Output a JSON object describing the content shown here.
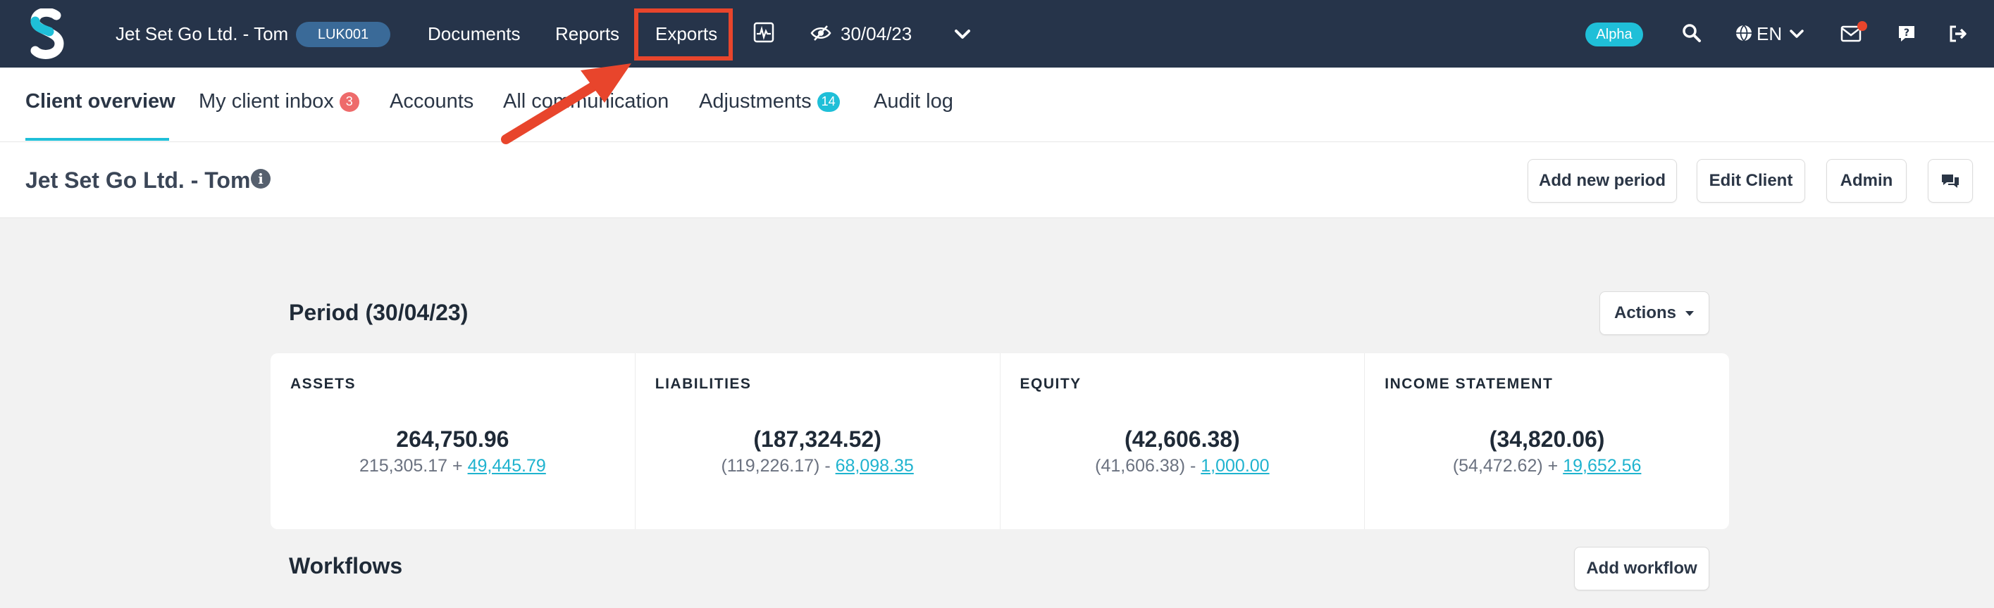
{
  "topbar": {
    "client_name": "Jet Set Go Ltd. - Tom",
    "client_code": "LUK001",
    "nav": {
      "documents": "Documents",
      "reports": "Reports",
      "exports": "Exports"
    },
    "period_date": "30/04/23",
    "alpha_badge": "Alpha",
    "language": "EN",
    "highlight_color": "#e8452c",
    "icons": [
      "logo-s-icon",
      "activity-chart-icon",
      "eye-slash-icon",
      "chevron-down-icon",
      "search-icon",
      "globe-icon",
      "mail-icon",
      "help-icon",
      "logout-icon"
    ]
  },
  "tabs": [
    {
      "label": "Client overview",
      "active": true
    },
    {
      "label": "My client inbox",
      "count": "3"
    },
    {
      "label": "Accounts"
    },
    {
      "label": "All communication"
    },
    {
      "label": "Adjustments",
      "count": "14"
    },
    {
      "label": "Audit log"
    }
  ],
  "header": {
    "title": "Jet Set Go Ltd. - Tom",
    "buttons": {
      "add_period": "Add new period",
      "edit_client": "Edit Client",
      "admin": "Admin"
    }
  },
  "period": {
    "title": "Period (30/04/23)",
    "actions_label": "Actions",
    "columns": [
      {
        "label": "ASSETS",
        "total": "264,750.96",
        "base": "215,305.17",
        "op": "+",
        "adjustment": "49,445.79"
      },
      {
        "label": "LIABILITIES",
        "total": "(187,324.52)",
        "base": "(119,226.17)",
        "op": "-",
        "adjustment": "68,098.35"
      },
      {
        "label": "EQUITY",
        "total": "(42,606.38)",
        "base": "(41,606.38)",
        "op": "-",
        "adjustment": "1,000.00"
      },
      {
        "label": "INCOME STATEMENT",
        "total": "(34,820.06)",
        "base": "(54,472.62)",
        "op": "+",
        "adjustment": "19,652.56"
      }
    ]
  },
  "workflows": {
    "title": "Workflows",
    "add_label": "Add workflow"
  }
}
